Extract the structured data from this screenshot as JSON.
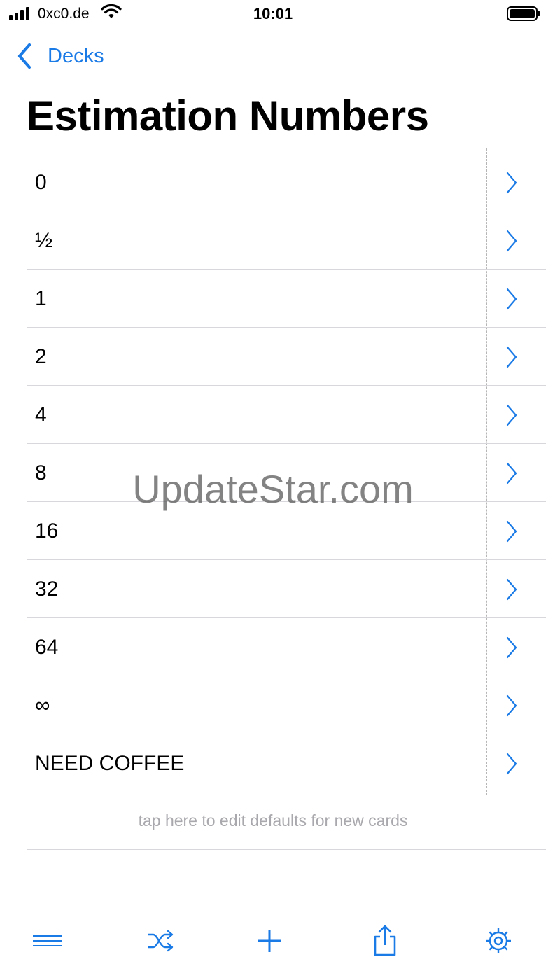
{
  "status_bar": {
    "carrier": "0xc0.de",
    "time": "10:01"
  },
  "nav": {
    "back_label": "Decks"
  },
  "title": "Estimation Numbers",
  "cards": [
    {
      "label": "0"
    },
    {
      "label": "½"
    },
    {
      "label": "1"
    },
    {
      "label": "2"
    },
    {
      "label": "4"
    },
    {
      "label": "8"
    },
    {
      "label": "16"
    },
    {
      "label": "32"
    },
    {
      "label": "64"
    },
    {
      "label": "∞"
    },
    {
      "label": "NEED COFFEE"
    }
  ],
  "defaults_hint": "tap here to edit defaults for new cards",
  "watermark": "UpdateStar.com",
  "toolbar": {
    "icons": [
      "menu-icon",
      "shuffle-icon",
      "add-icon",
      "share-icon",
      "settings-icon"
    ]
  },
  "colors": {
    "accent": "#1a7ae6",
    "separator": "#d8d8dc",
    "hint_text": "#a8a8ad"
  }
}
